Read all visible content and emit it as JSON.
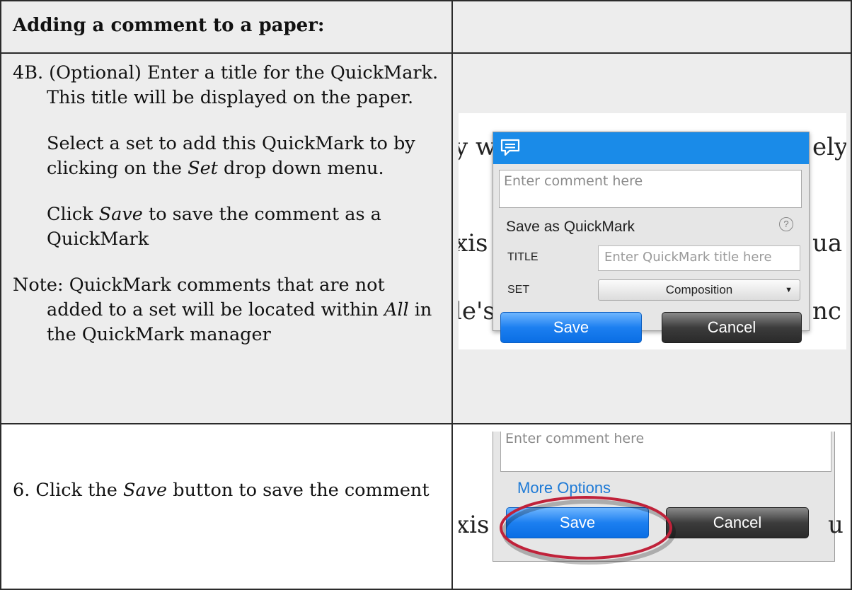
{
  "header": {
    "title": "Adding a comment to a paper:"
  },
  "step_4b": {
    "lead": "4B. (Optional) Enter a title for the QuickMark. This title will be displayed on the paper.",
    "select_set": [
      "Select a set to add this QuickMark to by clicking on the ",
      "Set",
      " drop down menu."
    ],
    "click_save": [
      "Click ",
      "Save",
      " to save the comment as a QuickMark"
    ],
    "note": [
      "Note: QuickMark comments that are not added to a set will be located within ",
      "All",
      " in the QuickMark manager"
    ]
  },
  "step_6": {
    "text": [
      "6. Click the ",
      "Save",
      " button to save the comment"
    ]
  },
  "screenshot_1": {
    "background_text": [
      "y w",
      "ely",
      "xis",
      "ua",
      "le's",
      "nc"
    ],
    "comment_placeholder": "Enter comment here",
    "save_as_quickmark_label": "Save as QuickMark",
    "help_icon_text": "?",
    "title_label": "TITLE",
    "title_placeholder": "Enter QuickMark title here",
    "set_label": "SET",
    "set_value": "Composition",
    "save_label": "Save",
    "cancel_label": "Cancel",
    "header_color": "#1a8be8",
    "icons": [
      "speech-bubble-icon",
      "help-icon",
      "dropdown-arrow-icon"
    ]
  },
  "screenshot_2": {
    "background_text": [
      "xis",
      "u"
    ],
    "comment_placeholder": "Enter comment here",
    "more_options_label": "More Options",
    "save_label": "Save",
    "cancel_label": "Cancel",
    "highlight_color": "#c0223a"
  }
}
